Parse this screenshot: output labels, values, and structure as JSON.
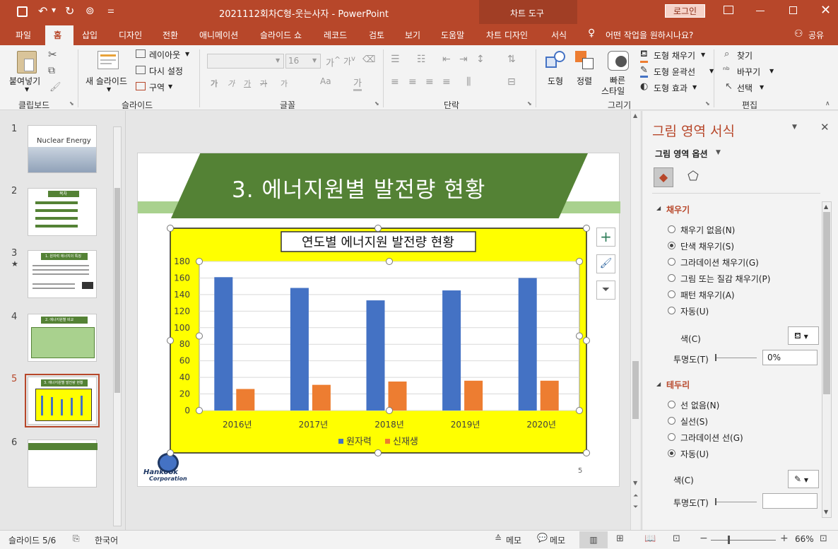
{
  "title_bar": {
    "document_title": "2021112회차C형-웃는사자  -  PowerPoint",
    "context_tool": "차트 도구",
    "login_label": "로그인"
  },
  "tabs": [
    "파일",
    "홈",
    "삽입",
    "디자인",
    "전환",
    "애니메이션",
    "슬라이드 쇼",
    "레코드",
    "검토",
    "보기",
    "도움말",
    "차트 디자인",
    "서식"
  ],
  "tell_me": "어떤 작업을 원하시나요?",
  "share_label": "공유",
  "ribbon": {
    "clipboard": {
      "paste": "붙여넣기",
      "group": "클립보드"
    },
    "slides": {
      "new_slide": "새 슬라이드",
      "layout": "레이아웃",
      "reset": "다시 설정",
      "section": "구역",
      "group": "슬라이드"
    },
    "font": {
      "size": "16",
      "group": "글꼴"
    },
    "paragraph": {
      "group": "단락"
    },
    "drawing": {
      "shapes": "도형",
      "arrange": "정렬",
      "quick_styles_1": "빠른",
      "quick_styles_2": "스타일",
      "fill": "도형 채우기",
      "outline": "도형 윤곽선",
      "effects": "도형 효과",
      "group": "그리기"
    },
    "editing": {
      "find": "찾기",
      "replace": "바꾸기",
      "select": "선택",
      "group": "편집"
    }
  },
  "thumbnails": [
    {
      "num": "1",
      "title": "Nuclear Energy"
    },
    {
      "num": "2",
      "title": "목차"
    },
    {
      "num": "3",
      "title": "1. 원자력 에너지의 특징"
    },
    {
      "num": "4",
      "title": "2. 에너지원별 비교"
    },
    {
      "num": "5",
      "title": "3. 에너지원별 발전량 현황"
    },
    {
      "num": "6",
      "title": ""
    }
  ],
  "slide": {
    "title": "3. 에너지원별 발전량 현황",
    "page_number": "5",
    "logo_text_1": "Hankook",
    "logo_text_2": "Corporation"
  },
  "chart_data": {
    "type": "bar",
    "title": "연도별 에너지원 발전량 현황",
    "categories": [
      "2016년",
      "2017년",
      "2018년",
      "2019년",
      "2020년"
    ],
    "series": [
      {
        "name": "원자력",
        "values": [
          161,
          148,
          133,
          145,
          160
        ],
        "color": "#4472c4"
      },
      {
        "name": "신재생",
        "values": [
          26,
          31,
          35,
          36,
          36
        ],
        "color": "#ed7d31"
      }
    ],
    "ylim": [
      0,
      180
    ],
    "yticks": [
      "0",
      "20",
      "40",
      "60",
      "80",
      "100",
      "120",
      "140",
      "160",
      "180"
    ],
    "grid": true,
    "legend": "bottom",
    "chart_bg": "#ffff00"
  },
  "pane": {
    "title": "그림 영역 서식",
    "options_label": "그림 영역 옵션",
    "fill_section": "채우기",
    "fill_options": [
      {
        "label": "채우기 없음(N)",
        "checked": false
      },
      {
        "label": "단색 채우기(S)",
        "checked": true
      },
      {
        "label": "그라데이션 채우기(G)",
        "checked": false
      },
      {
        "label": "그림 또는 질감 채우기(P)",
        "checked": false
      },
      {
        "label": "패턴 채우기(A)",
        "checked": false
      },
      {
        "label": "자동(U)",
        "checked": false
      }
    ],
    "color_label": "색(C)",
    "transparency_label": "투명도(T)",
    "transparency_value": "0%",
    "border_section": "테두리",
    "border_options": [
      {
        "label": "선 없음(N)",
        "checked": false
      },
      {
        "label": "실선(S)",
        "checked": false
      },
      {
        "label": "그라데이션 선(G)",
        "checked": false
      },
      {
        "label": "자동(U)",
        "checked": true
      }
    ],
    "border_color_label": "색(C)",
    "border_transparency_label": "투명도(T)"
  },
  "status": {
    "slide_info": "슬라이드 5/6",
    "language": "한국어",
    "notes": "메모",
    "comments": "메모",
    "zoom": "66%"
  },
  "colors": {
    "accent": "#b7472a",
    "slide_green": "#548235"
  }
}
